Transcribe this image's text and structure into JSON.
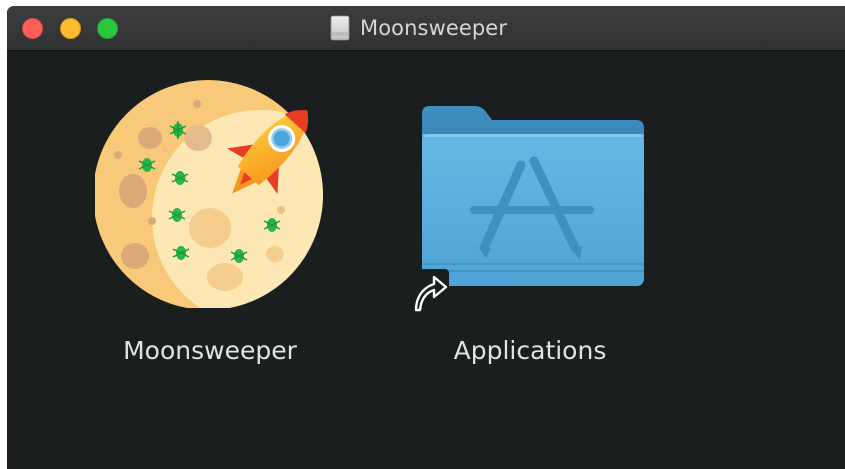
{
  "window": {
    "title": "Moonsweeper",
    "title_icon": "disk-image-icon"
  },
  "controls": {
    "close": "close-button",
    "minimize": "minimize-button",
    "zoom": "zoom-button",
    "colors": {
      "close": "#fe5f57",
      "minimize": "#febc2e",
      "zoom": "#29c840"
    }
  },
  "items": [
    {
      "label": "Moonsweeper",
      "icon": "moon-rocket-app-icon"
    },
    {
      "label": "Applications",
      "icon": "applications-folder-icon",
      "badge": "alias-arrow-icon"
    }
  ],
  "colors": {
    "background": "#1b1e1f",
    "titlebar": "#343536",
    "label": "#e2e2e2",
    "folder": "#5fb2e0"
  }
}
